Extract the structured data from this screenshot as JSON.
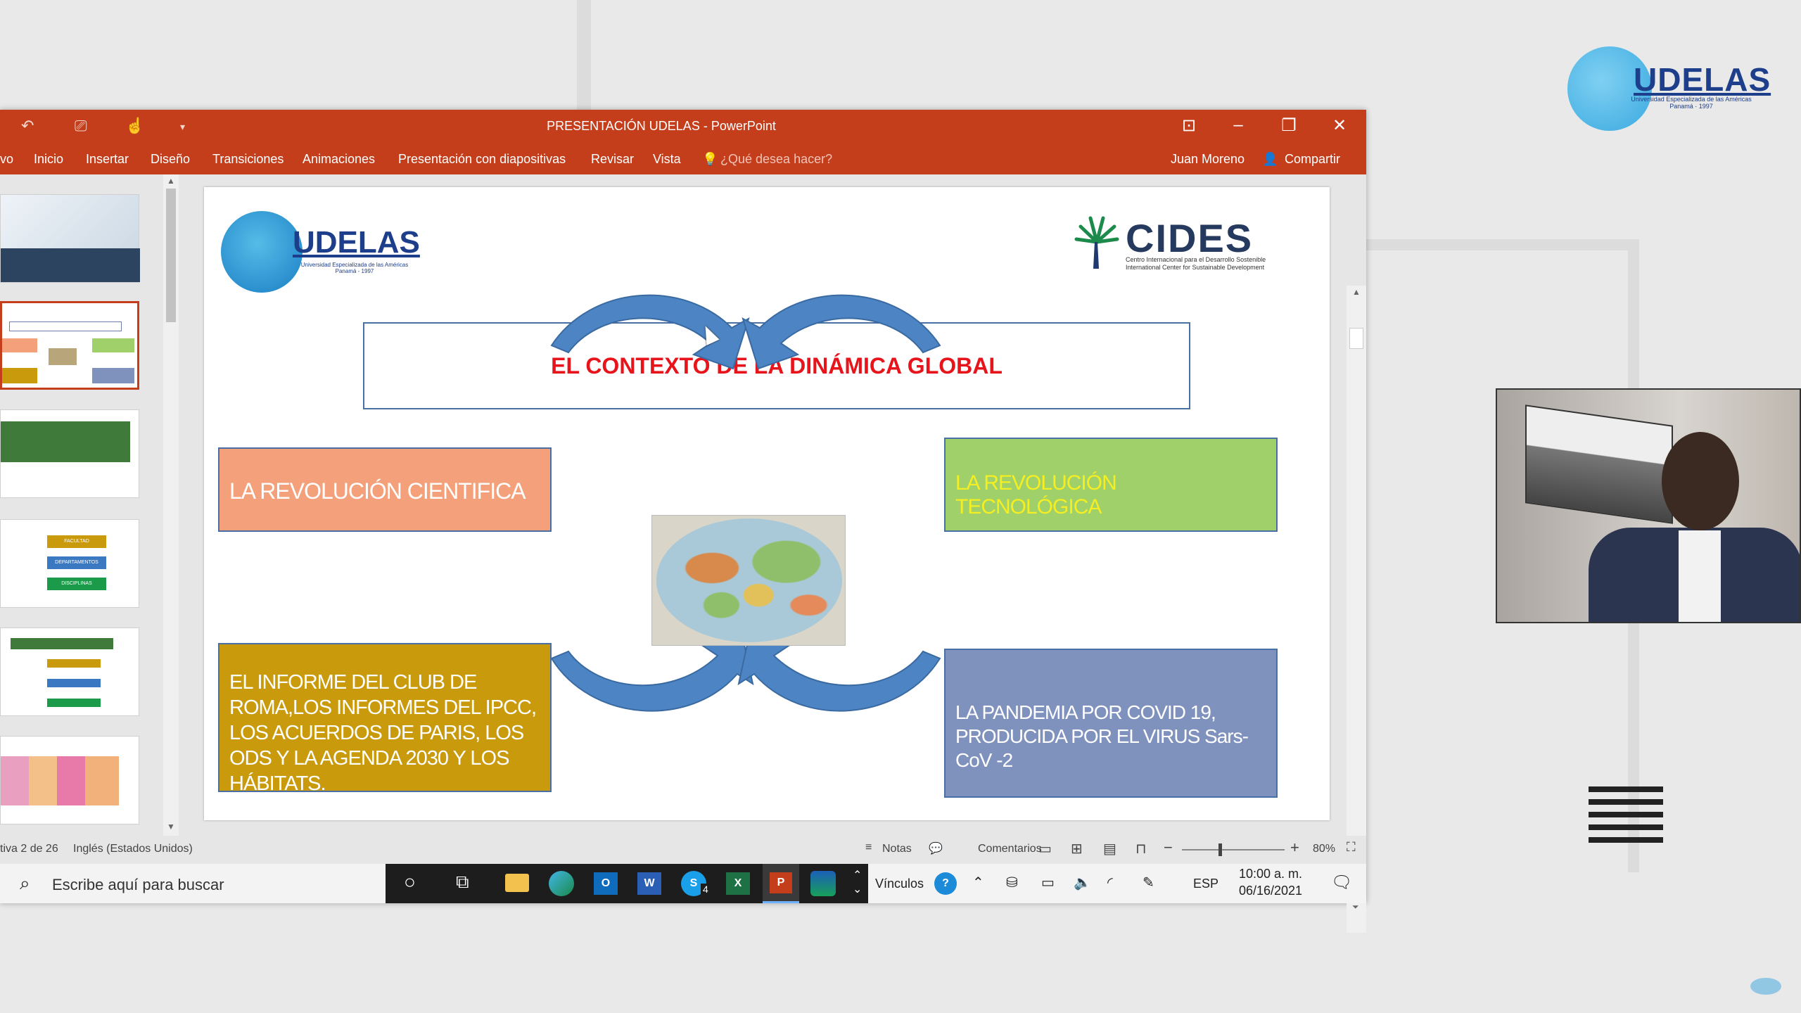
{
  "window": {
    "title": "PRESENTACIÓN UDELAS - PowerPoint"
  },
  "ribbon": {
    "tabs": [
      "vo",
      "Inicio",
      "Insertar",
      "Diseño",
      "Transiciones",
      "Animaciones",
      "Presentación con diapositivas",
      "Revisar",
      "Vista"
    ],
    "tell_me": "¿Qué desea hacer?",
    "user": "Juan Moreno",
    "share": "Compartir"
  },
  "brand_logo": {
    "name": "UDELAS",
    "subtitle": "Universidad Especializada de las Américas Panamá · 1997"
  },
  "slide": {
    "udelas_logo": {
      "name": "UDELAS",
      "subtitle": "Universidad Especializada de las Américas Panamá - 1997"
    },
    "cides_logo": {
      "name": "CIDES",
      "line1": "Centro Internacional para el Desarrollo Sostenible",
      "line2": "International Center for Sustainable Development"
    },
    "title": "EL CONTEXTO DE LA DINÁMICA GLOBAL",
    "box_top_left": "LA REVOLUCIÓN CIENTIFICA",
    "box_top_right": "LA REVOLUCIÓN TECNOLÓGICA",
    "box_bottom_left": "EL INFORME DEL CLUB DE ROMA,LOS INFORMES DEL IPCC, LOS ACUERDOS DE PARIS, LOS ODS Y LA AGENDA 2030 Y LOS HÁBITATS.",
    "box_bottom_right": "LA PANDEMIA  POR  COVID 19, PRODUCIDA POR EL  VIRUS Sars-CoV -2",
    "colors": {
      "title": "#e8141b",
      "top_left": "#f4a07a",
      "top_right": "#9fd06a",
      "bottom_left": "#c89a0c",
      "bottom_right": "#7f91bd",
      "arrow": "#4d84c3"
    }
  },
  "thumbnails": {
    "mini_labels": [
      "FACULTAD",
      "DEPARTAMENTOS",
      "DISCIPLINAS"
    ]
  },
  "statusbar": {
    "slide_info": "tiva 2 de 26",
    "language": "Inglés (Estados Unidos)",
    "notes": "Notas",
    "comments": "Comentarios",
    "zoom": "80%"
  },
  "taskbar": {
    "search_placeholder": "Escribe aquí para buscar",
    "links": "Vínculos",
    "lang": "ESP",
    "time": "10:00 a. m.",
    "date": "06/16/2021",
    "skype_badge": "4"
  }
}
